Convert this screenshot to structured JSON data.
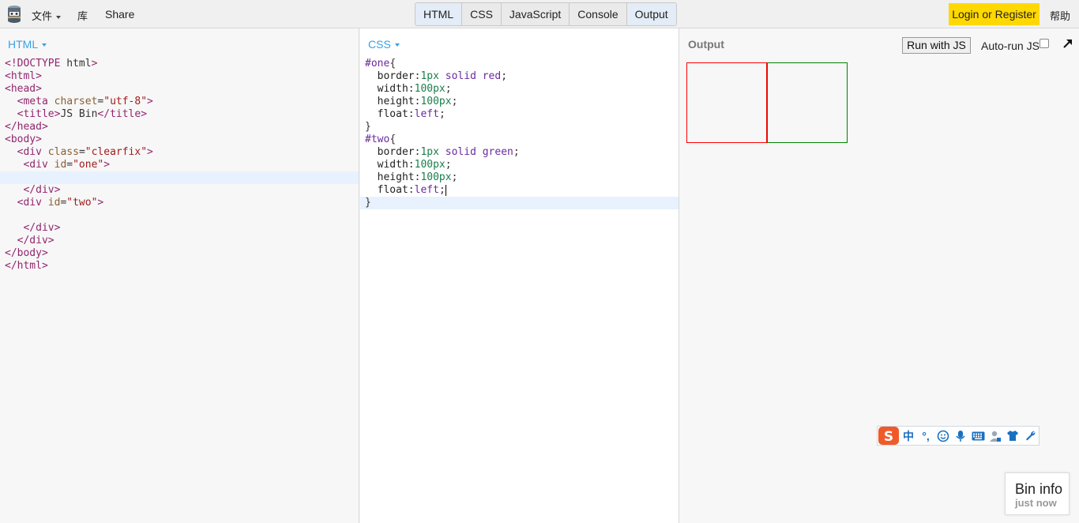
{
  "topbar": {
    "logo_icon": "jsbin-logo-icon",
    "file_menu": "文件",
    "library_menu": "库",
    "share": "Share",
    "panel_tabs": [
      {
        "label": "HTML",
        "active": true
      },
      {
        "label": "CSS",
        "active": false
      },
      {
        "label": "JavaScript",
        "active": false
      },
      {
        "label": "Console",
        "active": false
      },
      {
        "label": "Output",
        "active": true
      }
    ],
    "login": "Login or Register",
    "help": "帮助",
    "accent_color": "#ffd800"
  },
  "html_panel": {
    "label": "HTML",
    "lines": [
      "<!DOCTYPE html>",
      "<html>",
      "<head>",
      "  <meta charset=\"utf-8\">",
      "  <title>JS Bin</title>",
      "</head>",
      "<body>",
      "  <div class=\"clearfix\">",
      "   <div id=\"one\">",
      "",
      "   </div>",
      "  <div id=\"two\">",
      "",
      "   </div>",
      "  </div>",
      "</body>",
      "</html>"
    ],
    "highlighted_line": 9
  },
  "css_panel": {
    "label": "CSS",
    "lines": [
      "#one{",
      "  border:1px solid red;",
      "  width:100px;",
      "  height:100px;",
      "  float:left;",
      "}",
      "#two{",
      "  border:1px solid green;",
      "  width:100px;",
      "  height:100px;",
      "  float:left;",
      "}"
    ],
    "highlighted_line": 11
  },
  "output_panel": {
    "label": "Output",
    "run_button": "Run with JS",
    "autorun_label": "Auto-run JS",
    "autorun_checked": false,
    "popout_icon": "popout-arrow-icon",
    "box_one_color": "#ff0000",
    "box_two_color": "#008000"
  },
  "ime_toolbar": {
    "icons": [
      "sogou-logo-icon",
      "chinese-mode-icon",
      "punctuation-icon",
      "emoji-icon",
      "microphone-icon",
      "keyboard-icon",
      "user-icon",
      "skin-icon",
      "settings-wrench-icon"
    ],
    "chinese_char": "中",
    "punct_char": "°,"
  },
  "bin_info": {
    "title": "Bin info",
    "time": "just now"
  }
}
